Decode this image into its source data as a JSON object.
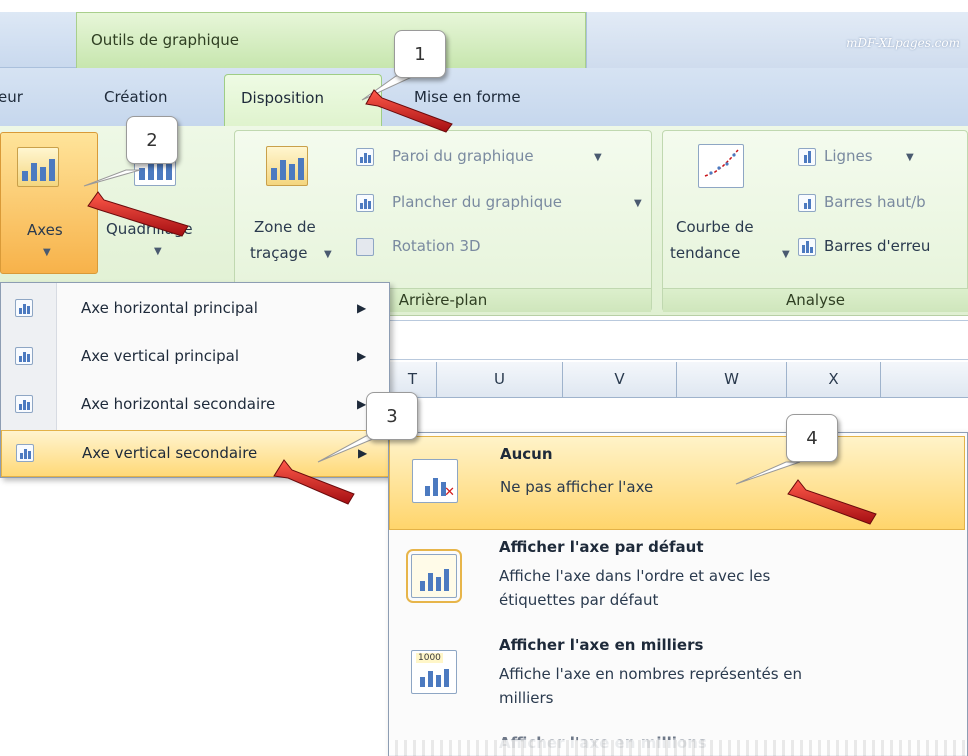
{
  "title_row": {
    "contextual_group": "Outils de graphique",
    "watermark": "mDF-XLpages.com"
  },
  "tabs": [
    {
      "label": "eur"
    },
    {
      "label": "Création"
    },
    {
      "label": "Disposition",
      "active": true
    },
    {
      "label": "Mise en forme"
    }
  ],
  "ribbon": {
    "axes": {
      "label": "Axes"
    },
    "quadrillage": {
      "label": "Quadrillage"
    },
    "zone_de_tracage": {
      "label_line1": "Zone de",
      "label_line2": "traçage"
    },
    "arriere_plan": {
      "items": [
        {
          "label": "Paroi du graphique"
        },
        {
          "label": "Plancher du graphique"
        },
        {
          "label": "Rotation 3D"
        }
      ],
      "group_label": "Arrière-plan"
    },
    "courbe_de_tendance": {
      "label_line1": "Courbe de",
      "label_line2": "tendance"
    },
    "analyse": {
      "items": [
        {
          "label": "Lignes"
        },
        {
          "label": "Barres haut/b"
        },
        {
          "label": "Barres d'erreu"
        }
      ],
      "group_label": "Analyse"
    }
  },
  "columns": [
    "T",
    "U",
    "V",
    "W",
    "X"
  ],
  "axes_menu": {
    "items": [
      {
        "label": "Axe horizontal principal",
        "has_submenu": true
      },
      {
        "label": "Axe vertical principal",
        "has_submenu": true
      },
      {
        "label": "Axe horizontal secondaire",
        "has_submenu": true
      },
      {
        "label": "Axe vertical secondaire",
        "has_submenu": true,
        "highlighted": true
      }
    ]
  },
  "submenu": {
    "options": [
      {
        "title": "Aucun",
        "desc_line1": "Ne pas afficher l'axe",
        "highlighted": true
      },
      {
        "title": "Afficher l'axe par défaut",
        "desc_line1": "Affiche l'axe dans l'ordre et avec les",
        "desc_line2": "étiquettes par défaut"
      },
      {
        "title": "Afficher l'axe en milliers",
        "desc_line1": "Affiche l'axe en nombres représentés en",
        "desc_line2": "milliers",
        "icon_text": "1000"
      },
      {
        "title": "Afficher l'axe en millions"
      }
    ]
  },
  "callouts": [
    "1",
    "2",
    "3",
    "4"
  ],
  "colors": {
    "highlight": "#ffd978",
    "arrow": "#c8141a",
    "ribbon_green": "#e0f0d2"
  }
}
